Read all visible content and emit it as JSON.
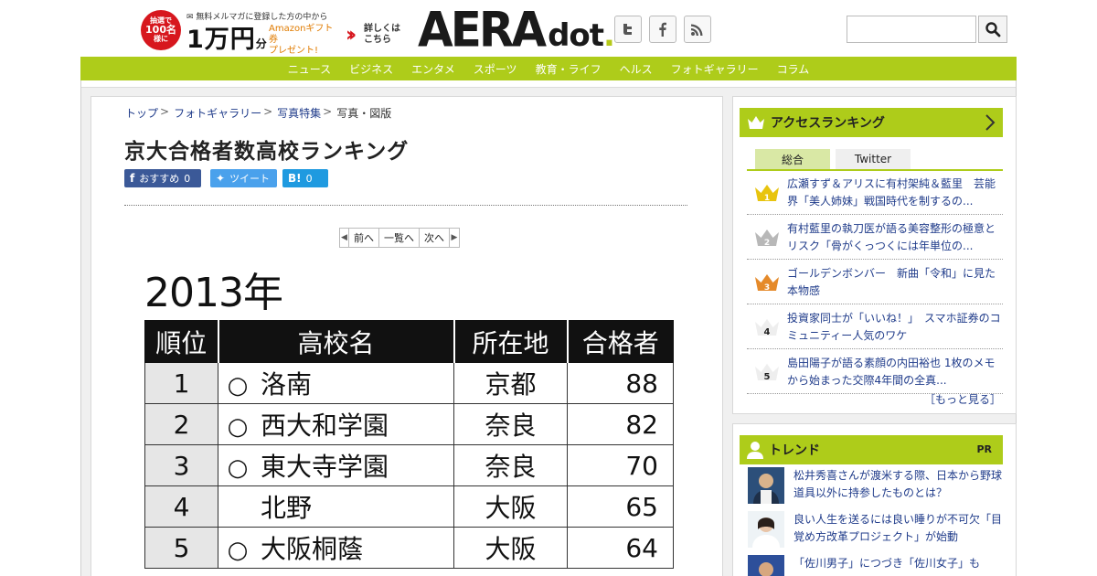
{
  "header": {
    "promo_badge_line1": "抽選で",
    "promo_badge_line2": "100名",
    "promo_badge_line3": "様に",
    "promo_top": "無料メルマガに登録した方の中から",
    "promo_amount": "1万円",
    "promo_amount_unit": "分",
    "promo_gift": "Amazonギフト券\nプレゼント!",
    "promo_detail": "詳しくは\nこちら",
    "logo_main": "AERA",
    "logo_sub": "dot",
    "logo_period": ".",
    "social_icons": [
      "twitter-icon",
      "facebook-icon",
      "rss-icon"
    ],
    "search_placeholder": ""
  },
  "nav": {
    "items": [
      "ニュース",
      "ビジネス",
      "エンタメ",
      "スポーツ",
      "教育・ライフ",
      "ヘルス",
      "フォトギャラリー",
      "コラム"
    ]
  },
  "article": {
    "breadcrumb": [
      "トップ",
      "フォトギャラリー",
      "写真特集",
      "写真・図版"
    ],
    "title": "京大合格者数高校ランキング",
    "share": {
      "facebook_label": "おすすめ",
      "facebook_count": "0",
      "twitter_label": "ツイート",
      "hatena_label": "B!",
      "hatena_count": "0"
    },
    "pager": {
      "prev": "前へ",
      "list": "一覧へ",
      "next": "次へ"
    },
    "figure": {
      "year": "2013年",
      "headers": [
        "順位",
        "高校名",
        "所在地",
        "合格者"
      ],
      "rows": [
        {
          "rank": "1",
          "mark": "○",
          "school": "洛南",
          "pref": "京都",
          "count": "88"
        },
        {
          "rank": "2",
          "mark": "○",
          "school": "西大和学園",
          "pref": "奈良",
          "count": "82"
        },
        {
          "rank": "3",
          "mark": "○",
          "school": "東大寺学園",
          "pref": "奈良",
          "count": "70"
        },
        {
          "rank": "4",
          "mark": "",
          "school": "北野",
          "pref": "大阪",
          "count": "65"
        },
        {
          "rank": "5",
          "mark": "○",
          "school": "大阪桐蔭",
          "pref": "大阪",
          "count": "64"
        }
      ]
    }
  },
  "sidebar": {
    "ranking": {
      "title": "アクセスランキング",
      "tabs": [
        "総合",
        "Twitter"
      ],
      "active_tab": "総合",
      "items": [
        {
          "rank": "1",
          "text": "広瀬すず＆アリスに有村架純＆藍里　芸能界「美人姉妹」戦国時代を制するの..."
        },
        {
          "rank": "2",
          "text": "有村藍里の執刀医が語る美容整形の極意とリスク「骨がくっつくには年単位の..."
        },
        {
          "rank": "3",
          "text": "ゴールデンボンバー　新曲「令和」に見た本物感"
        },
        {
          "rank": "4",
          "text": "投資家同士が「いいね！」　スマホ証券のコミュニティー人気のワケ"
        },
        {
          "rank": "5",
          "text": "島田陽子が語る素顔の内田裕也 1枚のメモから始まった交際4年間の全真..."
        }
      ],
      "more": "［もっと見る］"
    },
    "trend": {
      "title": "トレンド",
      "pr": "PR",
      "items": [
        {
          "text": "松井秀喜さんが渡米する際、日本から野球道具以外に持参したものとは？"
        },
        {
          "text": "良い人生を送るには良い睡りが不可欠「目覚め方改革プロジェクト」が始動"
        },
        {
          "text": "「佐川男子」につづき「佐川女子」も"
        }
      ]
    }
  },
  "colors": {
    "accent": "#aecc1a",
    "link": "#1f3b8a",
    "facebook": "#3b5998",
    "twitter": "#4aa1ec",
    "hatena": "#1f9ae0",
    "promo_red": "#d7171e",
    "crown_gold": "#e8c40f",
    "crown_silver": "#b8b8b8",
    "crown_bronze": "#e58a2a"
  }
}
